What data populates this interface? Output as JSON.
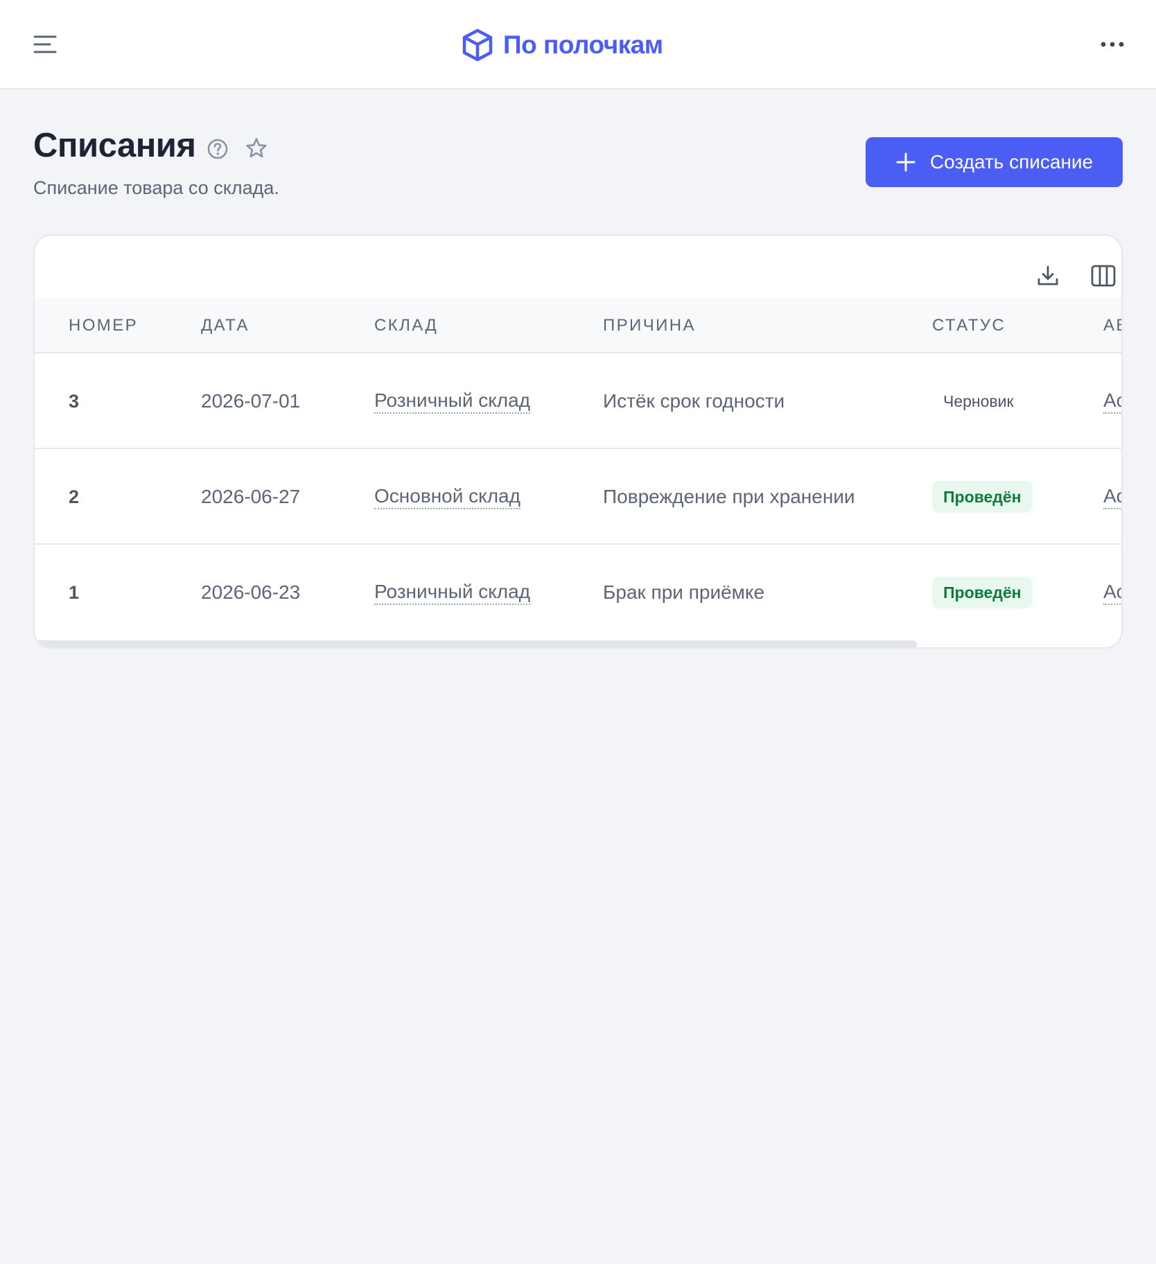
{
  "header": {
    "brand_name": "По полочкам",
    "menu_icon": "hamburger-menu-icon",
    "more_icon": "more-horizontal-icon",
    "accent_color": "#4a5df5"
  },
  "page": {
    "title": "Списания",
    "subtitle": "Списание товара со склада.",
    "create_button_label": "Создать списание"
  },
  "table": {
    "columns": [
      "НОМЕР",
      "ДАТА",
      "СКЛАД",
      "ПРИЧИНА",
      "СТАТУС",
      "АВ"
    ],
    "rows": [
      {
        "number": "3",
        "date": "2026-07-01",
        "warehouse": "Розничный склад",
        "reason": "Истёк срок годности",
        "status": "Черновик",
        "author": "Ас"
      },
      {
        "number": "2",
        "date": "2026-06-27",
        "warehouse": "Основной склад",
        "reason": "Повреждение при хранении",
        "status": "Проведён",
        "author": "Ас"
      },
      {
        "number": "1",
        "date": "2026-06-23",
        "warehouse": "Розничный склад",
        "reason": "Брак при приёмке",
        "status": "Проведён",
        "author": "Ас"
      }
    ],
    "horizontal_scroll_fraction": 0.81
  }
}
